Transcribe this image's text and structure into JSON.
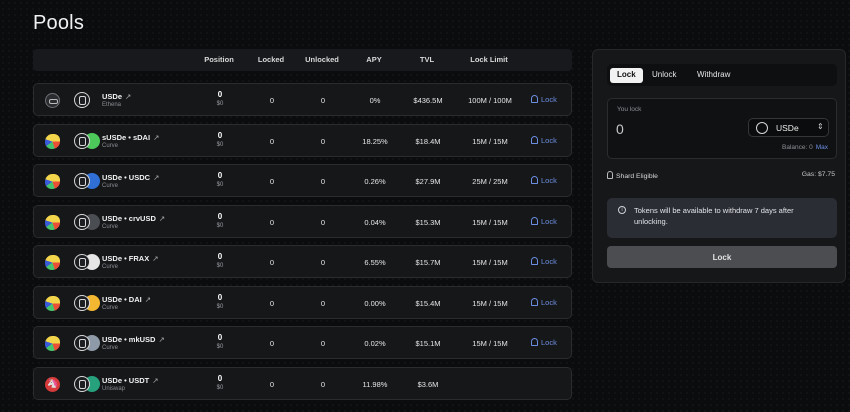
{
  "page": {
    "title": "Pools"
  },
  "columns": [
    "Position",
    "Locked",
    "Unlocked",
    "APY",
    "TVL",
    "Lock Limit"
  ],
  "rows": [
    {
      "protocol": "Ethena",
      "pool_icon": "ethena-icon",
      "name": "USDe",
      "second_token_color": "",
      "position": "0",
      "position_usd": "$0",
      "locked": "0",
      "unlocked": "0",
      "apy": "0%",
      "tvl": "$436.5M",
      "limit": "100M / 100M",
      "action": "Lock"
    },
    {
      "protocol": "Curve",
      "pool_icon": "curve-icon",
      "name": "sUSDe • sDAI",
      "second_token_color": "#4cc95a",
      "position": "0",
      "position_usd": "$0",
      "locked": "0",
      "unlocked": "0",
      "apy": "18.25%",
      "tvl": "$18.4M",
      "limit": "15M / 15M",
      "action": "Lock"
    },
    {
      "protocol": "Curve",
      "pool_icon": "curve-icon",
      "name": "USDe • USDC",
      "second_token_color": "#2f6fd6",
      "position": "0",
      "position_usd": "$0",
      "locked": "0",
      "unlocked": "0",
      "apy": "0.26%",
      "tvl": "$27.9M",
      "limit": "25M / 25M",
      "action": "Lock"
    },
    {
      "protocol": "Curve",
      "pool_icon": "curve-icon",
      "name": "USDe • crvUSD",
      "second_token_color": "#4a4d52",
      "position": "0",
      "position_usd": "$0",
      "locked": "0",
      "unlocked": "0",
      "apy": "0.04%",
      "tvl": "$15.3M",
      "limit": "15M / 15M",
      "action": "Lock"
    },
    {
      "protocol": "Curve",
      "pool_icon": "curve-icon",
      "name": "USDe • FRAX",
      "second_token_color": "#e6e6e6",
      "position": "0",
      "position_usd": "$0",
      "locked": "0",
      "unlocked": "0",
      "apy": "6.55%",
      "tvl": "$15.7M",
      "limit": "15M / 15M",
      "action": "Lock"
    },
    {
      "protocol": "Curve",
      "pool_icon": "curve-icon",
      "name": "USDe • DAI",
      "second_token_color": "#f4b731",
      "position": "0",
      "position_usd": "$0",
      "locked": "0",
      "unlocked": "0",
      "apy": "0.00%",
      "tvl": "$15.4M",
      "limit": "15M / 15M",
      "action": "Lock"
    },
    {
      "protocol": "Curve",
      "pool_icon": "curve-icon",
      "name": "USDe • mkUSD",
      "second_token_color": "#8f9aa8",
      "position": "0",
      "position_usd": "$0",
      "locked": "0",
      "unlocked": "0",
      "apy": "0.02%",
      "tvl": "$15.1M",
      "limit": "15M / 15M",
      "action": "Lock"
    },
    {
      "protocol": "Uniswap",
      "pool_icon": "uniswap-icon",
      "name": "USDe • USDT",
      "second_token_color": "#26a17b",
      "position": "0",
      "position_usd": "$0",
      "locked": "0",
      "unlocked": "0",
      "apy": "11.98%",
      "tvl": "$3.6M",
      "limit": "",
      "action": ""
    }
  ],
  "panel": {
    "tabs": [
      "Lock",
      "Unlock",
      "Withdraw"
    ],
    "you_lock_label": "You lock",
    "amount_value": "0",
    "token": "USDe",
    "balance_label": "Balance: 0",
    "max_label": "Max",
    "shard_label": "Shard Eligible",
    "gas_label": "Gas: $7.75",
    "notice": "Tokens will be available to withdraw 7 days after unlocking.",
    "lock_button": "Lock"
  },
  "colors": {
    "accent": "#6d8fe3",
    "background": "#0b0c0e",
    "row": "#161719"
  }
}
